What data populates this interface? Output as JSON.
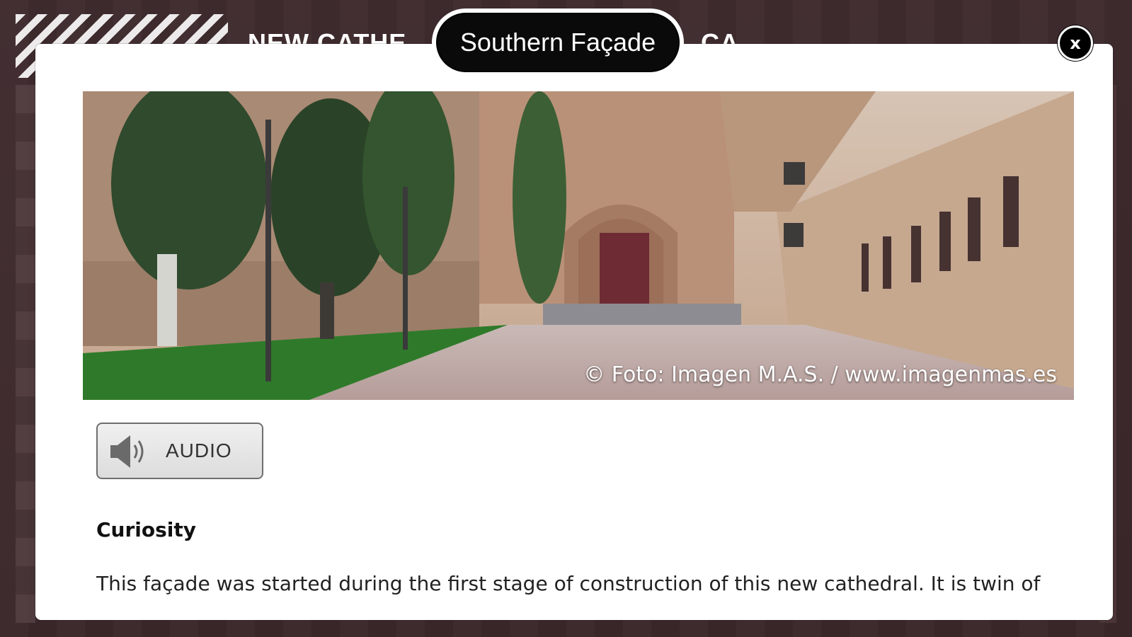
{
  "background": {
    "title_left": "NEW CATHE",
    "title_right": "CA"
  },
  "modal": {
    "title": "Southern Façade",
    "close_label": "x",
    "hero_image": {
      "photo_credit": "© Foto: Imagen M.A.S. / www.imagenmas.es"
    },
    "audio_button": {
      "label": "AUDIO",
      "icon": "speaker-icon"
    },
    "section_heading": "Curiosity",
    "body_text": "This façade was started during the first stage of construction of this new cathedral. It is twin of"
  },
  "colors": {
    "page_background": "#3d2a2c",
    "modal_background": "#ffffff",
    "pill_background": "#0a0a0a",
    "close_background": "#000000"
  }
}
